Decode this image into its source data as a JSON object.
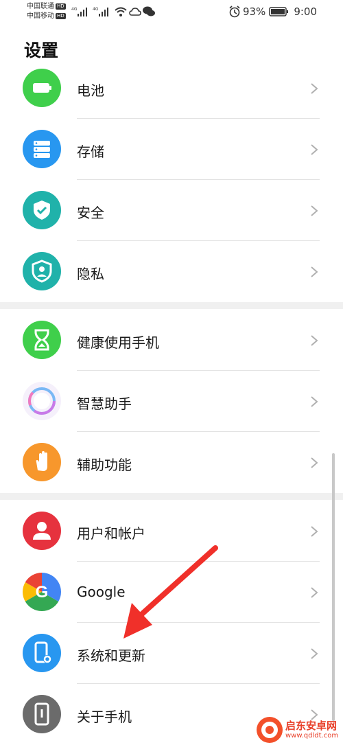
{
  "status_bar": {
    "carrier1": "中国联通",
    "carrier2": "中国移动",
    "hd_badge": "HD",
    "network": "4G",
    "battery": "93%",
    "time": "9:00"
  },
  "page": {
    "title": "设置"
  },
  "settings_items": [
    {
      "label": "电池",
      "icon": "battery-icon",
      "color": "#3fcf4b"
    },
    {
      "label": "存储",
      "icon": "storage-icon",
      "color": "#2897f0"
    },
    {
      "label": "安全",
      "icon": "security-shield-icon",
      "color": "#20b2aa"
    },
    {
      "label": "隐私",
      "icon": "privacy-icon",
      "color": "#20b2aa"
    },
    {
      "label": "健康使用手机",
      "icon": "hourglass-icon",
      "color": "#3fcf4b"
    },
    {
      "label": "智慧助手",
      "icon": "assistant-icon",
      "color": "#a98cf0"
    },
    {
      "label": "辅助功能",
      "icon": "hand-icon",
      "color": "#f7972c"
    },
    {
      "label": "用户和帐户",
      "icon": "user-icon",
      "color": "#e6323e"
    },
    {
      "label": "Google",
      "icon": "google-icon",
      "color": "#4285f4"
    },
    {
      "label": "系统和更新",
      "icon": "phone-settings-icon",
      "color": "#2897f0"
    },
    {
      "label": "关于手机",
      "icon": "phone-info-icon",
      "color": "#6b6b6b"
    }
  ],
  "annotation": {
    "arrow_color": "#f0302a"
  },
  "watermark": {
    "text": "启东安卓网",
    "url_text": "www.qdldt.com"
  }
}
